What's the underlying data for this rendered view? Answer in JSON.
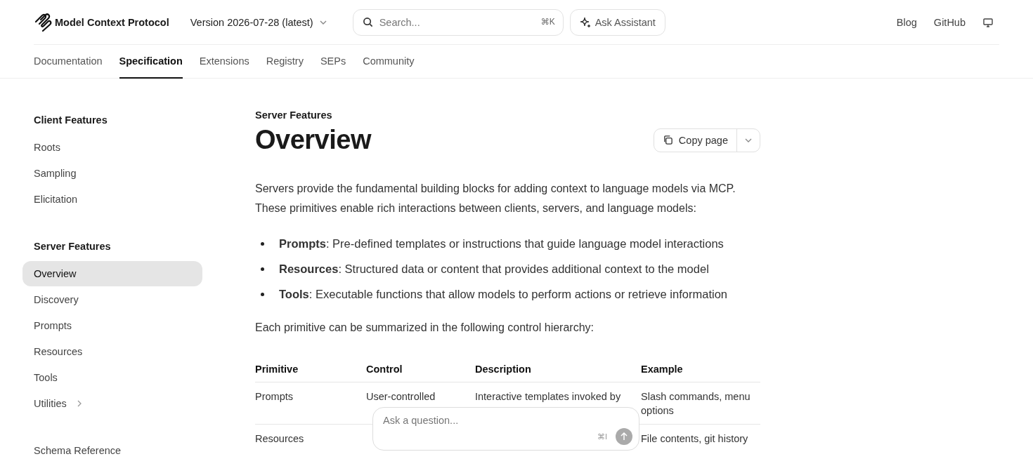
{
  "header": {
    "brand": "Model Context Protocol",
    "version": "Version 2026-07-28 (latest)",
    "search": {
      "placeholder": "Search...",
      "shortcut": "⌘K"
    },
    "assistant": "Ask Assistant",
    "links": [
      "Blog",
      "GitHub"
    ]
  },
  "tabs": [
    {
      "label": "Documentation",
      "selected": false
    },
    {
      "label": "Specification",
      "selected": true
    },
    {
      "label": "Extensions",
      "selected": false
    },
    {
      "label": "Registry",
      "selected": false
    },
    {
      "label": "SEPs",
      "selected": false
    },
    {
      "label": "Community",
      "selected": false
    }
  ],
  "sidebar": {
    "groups": [
      {
        "title": "Client Features",
        "items": [
          {
            "label": "Roots",
            "selected": false,
            "expandable": false
          },
          {
            "label": "Sampling",
            "selected": false,
            "expandable": false
          },
          {
            "label": "Elicitation",
            "selected": false,
            "expandable": false
          }
        ]
      },
      {
        "title": "Server Features",
        "items": [
          {
            "label": "Overview",
            "selected": true,
            "expandable": false
          },
          {
            "label": "Discovery",
            "selected": false,
            "expandable": false
          },
          {
            "label": "Prompts",
            "selected": false,
            "expandable": false
          },
          {
            "label": "Resources",
            "selected": false,
            "expandable": false
          },
          {
            "label": "Tools",
            "selected": false,
            "expandable": false
          },
          {
            "label": "Utilities",
            "selected": false,
            "expandable": true
          }
        ]
      }
    ],
    "footer_link": "Schema Reference"
  },
  "article": {
    "eyebrow": "Server Features",
    "title": "Overview",
    "copy_button": "Copy page",
    "intro": "Servers provide the fundamental building blocks for adding context to language models via MCP. These primitives enable rich interactions between clients, servers, and language models:",
    "bullets": [
      "**Prompts**: Pre-defined templates or instructions that guide language model interactions",
      "**Resources**: Structured data or content that provides additional context to the model",
      "**Tools**: Executable functions that allow models to perform actions or retrieve information"
    ],
    "lead": "Each primitive can be summarized in the following control hierarchy:",
    "table": {
      "columns": [
        "Primitive",
        "Control",
        "Description",
        "Example"
      ],
      "rows": [
        [
          "Prompts",
          "User-controlled",
          "Interactive templates invoked by",
          "Slash commands, menu options"
        ],
        [
          "Resources",
          "",
          "",
          "File contents, git history"
        ]
      ]
    }
  },
  "ask": {
    "placeholder": "Ask a question...",
    "shortcut": "⌘I"
  }
}
